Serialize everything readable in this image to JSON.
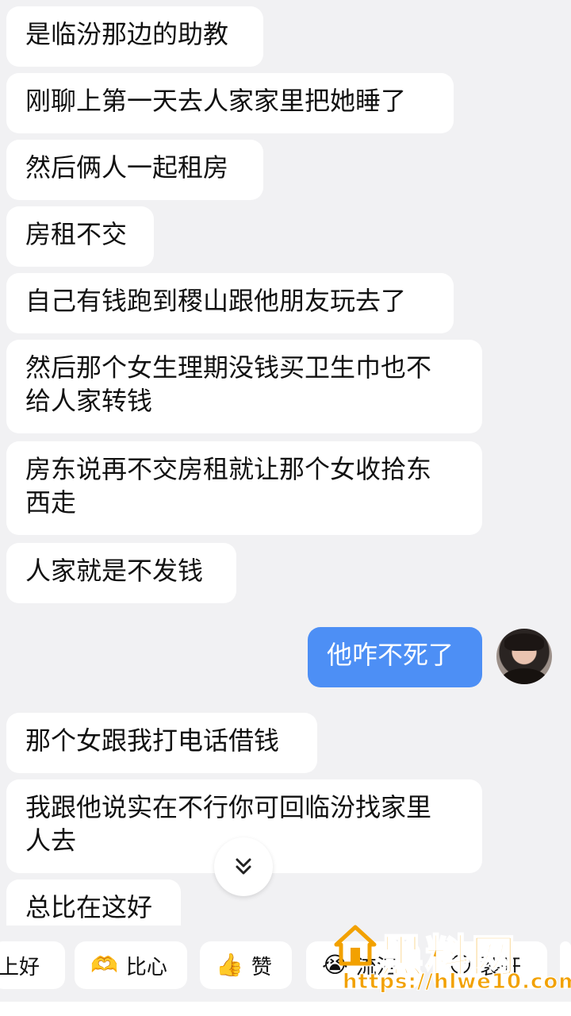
{
  "messages": [
    {
      "text": "是临汾那边的助教"
    },
    {
      "text": "刚聊上第一天去人家家里把她睡了"
    },
    {
      "text": "然后俩人一起租房"
    },
    {
      "text": "房租不交"
    },
    {
      "text": "自己有钱跑到稷山跟他朋友玩去了"
    },
    {
      "text": "然后那个女生理期没钱买卫生巾也不\n给人家转钱"
    },
    {
      "text": "房东说再不交房租就让那个女收拾东\n西走"
    },
    {
      "text": "人家就是不发钱"
    },
    {
      "text": "他咋不死了"
    },
    {
      "text": "那个女跟我打电话借钱"
    },
    {
      "text": "我跟他说实在不行你可回临汾找家里\n人去"
    },
    {
      "text": "总比在这好"
    }
  ],
  "scroll_down_icon": "double-chevron-down-icon",
  "quick_replies": [
    {
      "label": "上好",
      "icon": "partial-icon"
    },
    {
      "label": "比心",
      "icon": "heart-hands-icon"
    },
    {
      "label": "赞",
      "icon": "thumbs-up-icon"
    },
    {
      "label": "流泪",
      "icon": "crying-face-icon"
    },
    {
      "label": "裂开",
      "icon": "cracked-face-icon"
    }
  ],
  "watermark": {
    "title": "黑料网",
    "url": "https://hlwe10.com"
  },
  "colors": {
    "background": "#f1f1f3",
    "bubble_other": "#ffffff",
    "bubble_mine": "#4d8ff5",
    "watermark": "#f2a100"
  }
}
